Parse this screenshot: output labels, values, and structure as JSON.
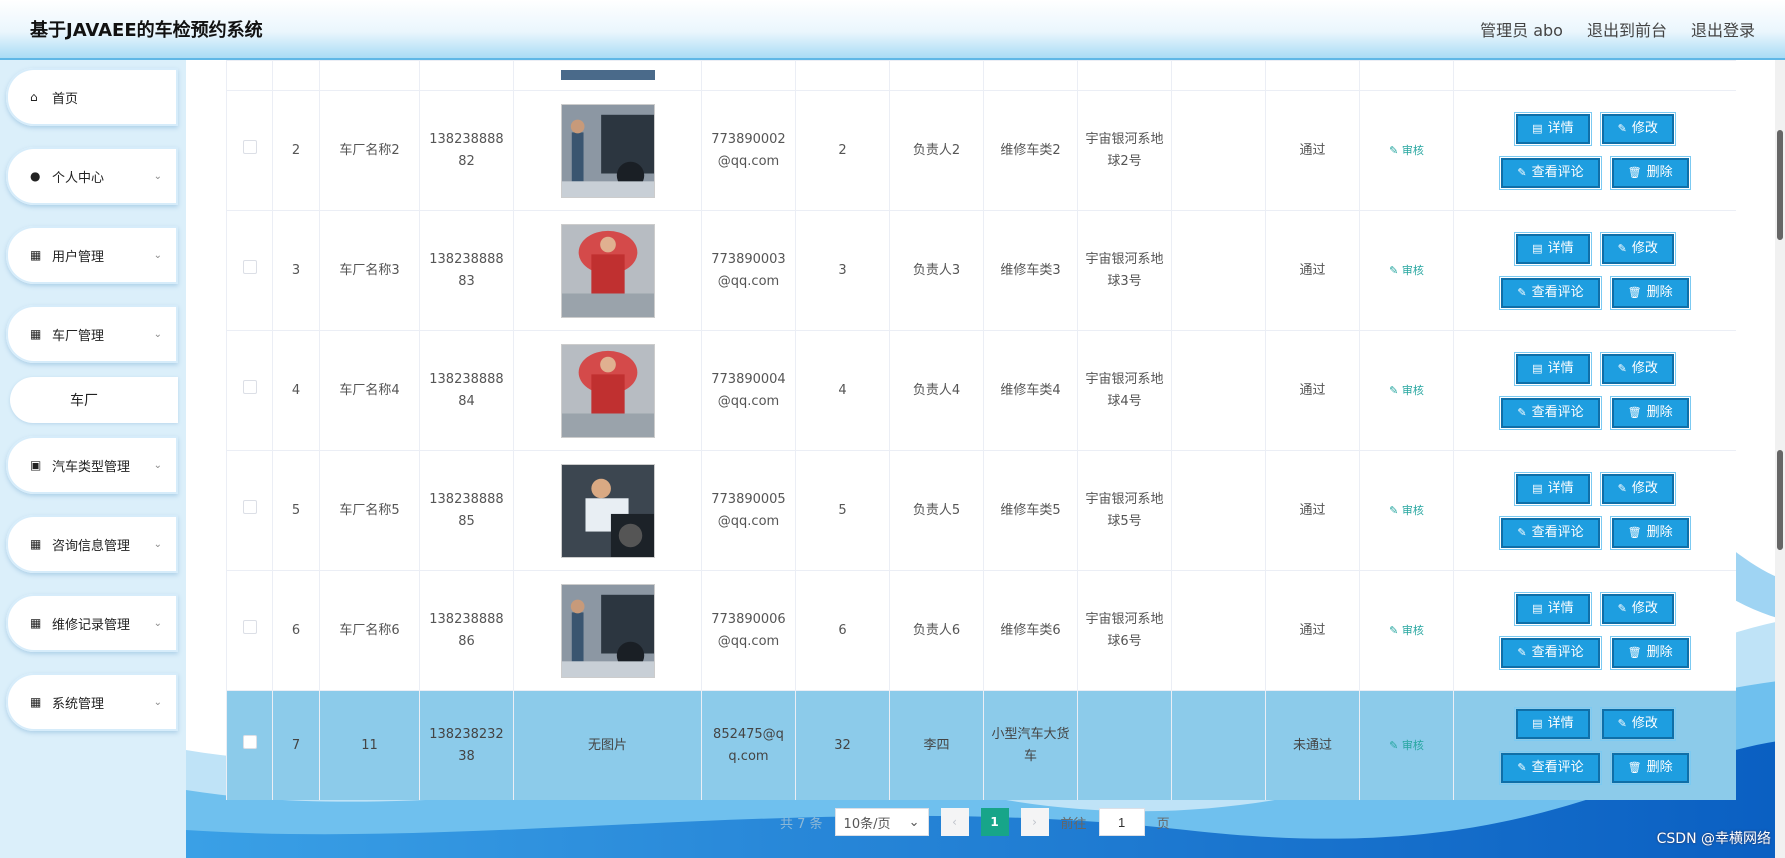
{
  "header": {
    "title": "基于JAVAEE的车检预约系统",
    "admin_label": "管理员 abo",
    "front_label": "退出到前台",
    "logout_label": "退出登录"
  },
  "sidebar": {
    "items": [
      {
        "label": "首页",
        "icon": "home-icon"
      },
      {
        "label": "个人中心",
        "icon": "user-icon"
      },
      {
        "label": "用户管理",
        "icon": "grid-icon"
      },
      {
        "label": "车厂管理",
        "icon": "grid-icon"
      },
      {
        "label": "汽车类型管理",
        "icon": "clipboard-icon"
      },
      {
        "label": "咨询信息管理",
        "icon": "grid-icon"
      },
      {
        "label": "维修记录管理",
        "icon": "grid-icon"
      },
      {
        "label": "系统管理",
        "icon": "grid-icon"
      }
    ],
    "submenu": {
      "label": "车厂"
    }
  },
  "table": {
    "rows": [
      {
        "index": "2",
        "name": "车厂名称2",
        "phone": "13823888882",
        "email": "773890002@qq.com",
        "num": "2",
        "manager": "负责人2",
        "category": "维修车类2",
        "address": "宇宙银河系地球2号",
        "extra": "",
        "status": "通过",
        "audit": "审核"
      },
      {
        "index": "3",
        "name": "车厂名称3",
        "phone": "13823888883",
        "email": "773890003@qq.com",
        "num": "3",
        "manager": "负责人3",
        "category": "维修车类3",
        "address": "宇宙银河系地球3号",
        "extra": "",
        "status": "通过",
        "audit": "审核"
      },
      {
        "index": "4",
        "name": "车厂名称4",
        "phone": "13823888884",
        "email": "773890004@qq.com",
        "num": "4",
        "manager": "负责人4",
        "category": "维修车类4",
        "address": "宇宙银河系地球4号",
        "extra": "",
        "status": "通过",
        "audit": "审核"
      },
      {
        "index": "5",
        "name": "车厂名称5",
        "phone": "13823888885",
        "email": "773890005@qq.com",
        "num": "5",
        "manager": "负责人5",
        "category": "维修车类5",
        "address": "宇宙银河系地球5号",
        "extra": "",
        "status": "通过",
        "audit": "审核"
      },
      {
        "index": "6",
        "name": "车厂名称6",
        "phone": "13823888886",
        "email": "773890006@qq.com",
        "num": "6",
        "manager": "负责人6",
        "category": "维修车类6",
        "address": "宇宙银河系地球6号",
        "extra": "",
        "status": "通过",
        "audit": "审核"
      },
      {
        "index": "7",
        "name": "11",
        "phone": "13823823238",
        "email": "852475@qq.com",
        "num": "32",
        "manager": "李四",
        "category": "小型汽车大货车",
        "address": "",
        "extra": "",
        "status": "未通过",
        "audit": "审核",
        "no_image": "无图片"
      }
    ],
    "buttons": {
      "detail": "详情",
      "edit": "修改",
      "comments": "查看评论",
      "delete": "删除"
    }
  },
  "pager": {
    "total": "共 7 条",
    "size": "10条/页",
    "current": "1",
    "goto_prefix": "前往",
    "goto_value": "1",
    "goto_suffix": "页"
  },
  "watermark": "CSDN @幸横网络",
  "colors": {
    "accent": "#1e9ee0",
    "selected_row": "#8ccbea",
    "page_current": "#17a589",
    "audit": "#27a6a0"
  }
}
